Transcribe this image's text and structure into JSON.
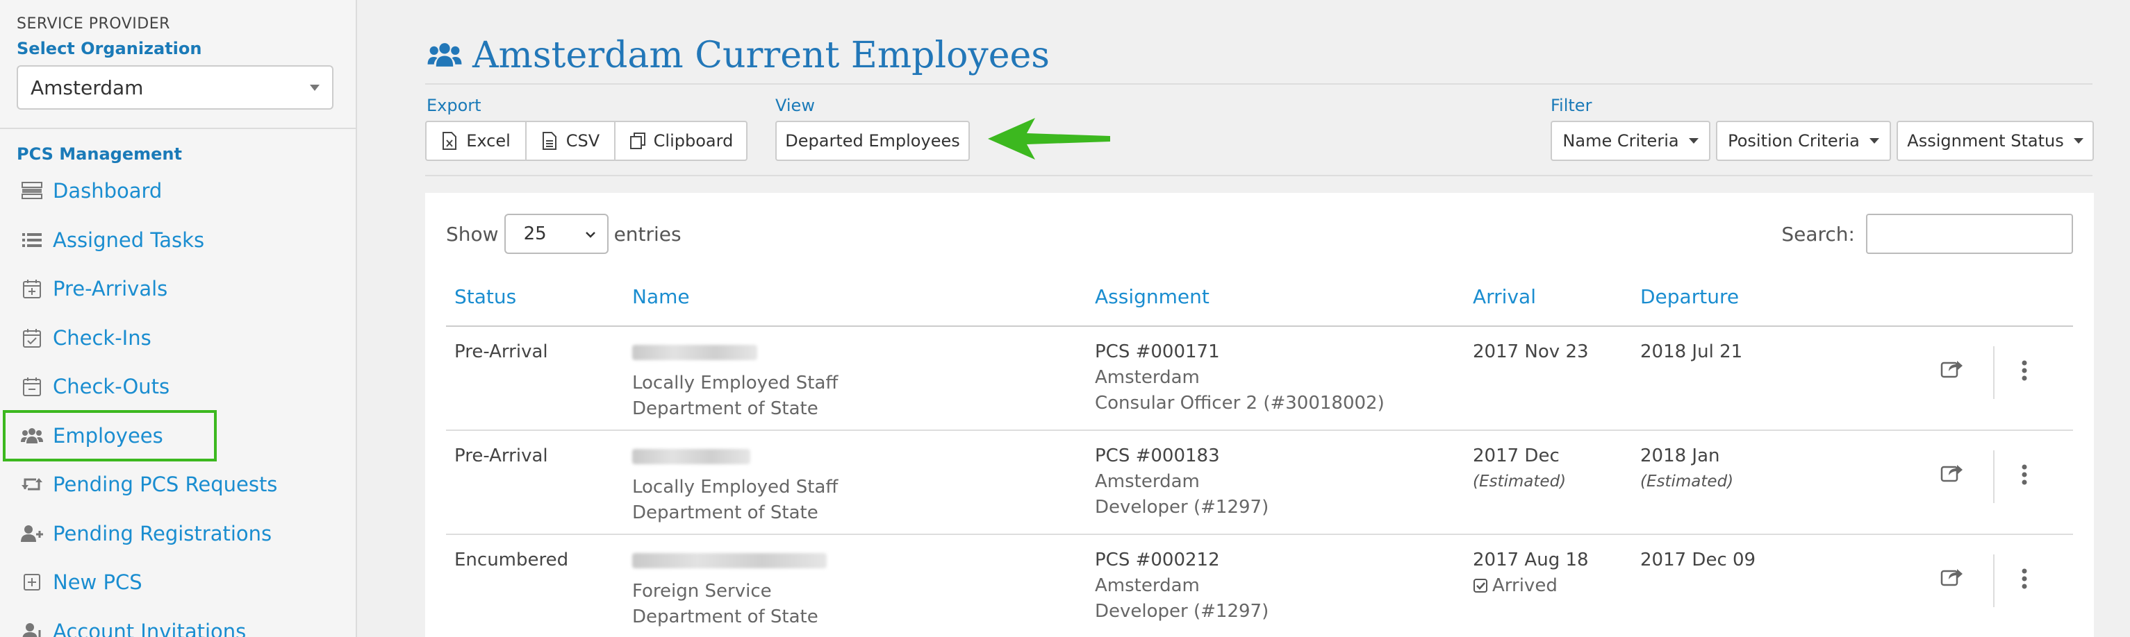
{
  "sidebar": {
    "service_provider_label": "SERVICE PROVIDER",
    "select_org_label": "Select Organization",
    "org_value": "Amsterdam",
    "section_label": "PCS Management",
    "items": [
      {
        "label": "Dashboard",
        "icon": "dashboard-icon"
      },
      {
        "label": "Assigned Tasks",
        "icon": "list-icon"
      },
      {
        "label": "Pre-Arrivals",
        "icon": "calendar-plus-icon"
      },
      {
        "label": "Check-Ins",
        "icon": "calendar-check-icon"
      },
      {
        "label": "Check-Outs",
        "icon": "calendar-minus-icon"
      },
      {
        "label": "Employees",
        "icon": "users-icon",
        "active": true
      },
      {
        "label": "Pending PCS Requests",
        "icon": "retweet-icon"
      },
      {
        "label": "Pending Registrations",
        "icon": "user-plus-icon"
      },
      {
        "label": "New PCS",
        "icon": "plus-square-icon"
      },
      {
        "label": "Account Invitations",
        "icon": "user-icon"
      }
    ]
  },
  "header": {
    "title": "Amsterdam Current Employees"
  },
  "toolbar": {
    "export_label": "Export",
    "excel": "Excel",
    "csv": "CSV",
    "clipboard": "Clipboard",
    "view_label": "View",
    "departed": "Departed Employees",
    "filter_label": "Filter",
    "name_criteria": "Name Criteria",
    "position_criteria": "Position Criteria",
    "assignment_status": "Assignment Status"
  },
  "table_controls": {
    "show": "Show",
    "entries_value": "25",
    "entries": "entries",
    "search": "Search:"
  },
  "table": {
    "columns": [
      "Status",
      "Name",
      "Assignment",
      "Arrival",
      "Departure"
    ],
    "rows": [
      {
        "status": "Pre-Arrival",
        "name_line2": "Locally Employed Staff",
        "name_line3": "Department of State",
        "pcs": "PCS #000171",
        "post": "Amsterdam",
        "position": "Consular Officer 2 (#30018002)",
        "arrival": "2017 Nov 23",
        "arrival_note": "",
        "departure": "2018 Jul 21",
        "departure_note": ""
      },
      {
        "status": "Pre-Arrival",
        "name_line2": "Locally Employed Staff",
        "name_line3": "Department of State",
        "pcs": "PCS #000183",
        "post": "Amsterdam",
        "position": "Developer (#1297)",
        "arrival": "2017 Dec",
        "arrival_note": "(Estimated)",
        "departure": "2018 Jan",
        "departure_note": "(Estimated)"
      },
      {
        "status": "Encumbered",
        "name_line2": "Foreign Service",
        "name_line3": "Department of State",
        "pcs": "PCS #000212",
        "post": "Amsterdam",
        "position": "Developer (#1297)",
        "arrival": "2017 Aug 18",
        "arrival_note": "Arrived",
        "departure": "2017 Dec 09",
        "departure_note": ""
      }
    ]
  },
  "colors": {
    "accent": "#1a8dd0",
    "title": "#2277b8",
    "highlight": "#3cb81f"
  }
}
